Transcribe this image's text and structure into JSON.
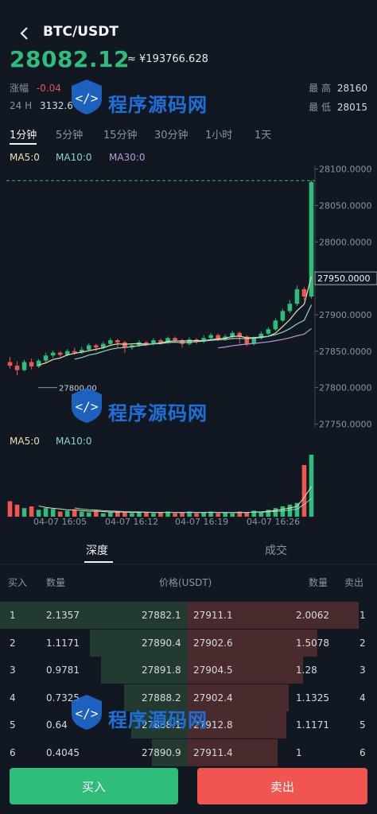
{
  "header": {
    "title": "BTC/USDT",
    "back_icon": "chevron-left-icon"
  },
  "ticker": {
    "price": "28082.12",
    "cny": "≈ ¥193766.628",
    "change_label": "涨幅",
    "change_value": "-0.04",
    "vol_label": "24 H",
    "vol_value": "3132.6",
    "high_label": "最 高",
    "high_value": "28160",
    "low_label": "最 低",
    "low_value": "28015"
  },
  "intervals": [
    "1分钟",
    "5分钟",
    "15分钟",
    "30分钟",
    "1小时",
    "1天"
  ],
  "ma_legend": {
    "ma5": "MA5:0",
    "ma10": "MA10:0",
    "ma30": "MA30:0"
  },
  "vol_legend": {
    "ma5": "MA5:0",
    "ma10": "MA10:0"
  },
  "colors": {
    "up": "#2ebd7a",
    "down": "#f0564f",
    "ma5": "#e8e0b0",
    "ma10": "#8fd3c8",
    "ma30": "#b79ae0"
  },
  "chart_data": {
    "type": "candlestick",
    "y_ticks": [
      "28100.0000",
      "28050.0000",
      "28000.0000",
      "27950.0000",
      "27900.0000",
      "27850.0000",
      "27800.0000",
      "27750.0000"
    ],
    "ylim": [
      27745,
      28105
    ],
    "current_price_label": "27950.0000",
    "high_marker": "28082",
    "low_marker": "27800.00",
    "x_ticks": [
      "04-07 16:05",
      "04-07 16:12",
      "04-07 16:19",
      "04-07 16:26"
    ],
    "candles": [
      [
        27835,
        27830,
        27842,
        27826
      ],
      [
        27830,
        27824,
        27836,
        27817
      ],
      [
        27824,
        27835,
        27838,
        27822
      ],
      [
        27835,
        27829,
        27840,
        27825
      ],
      [
        27829,
        27837,
        27839,
        27827
      ],
      [
        27837,
        27844,
        27848,
        27834
      ],
      [
        27844,
        27848,
        27851,
        27841
      ],
      [
        27848,
        27845,
        27850,
        27842
      ],
      [
        27845,
        27850,
        27853,
        27843
      ],
      [
        27850,
        27848,
        27855,
        27845
      ],
      [
        27848,
        27852,
        27856,
        27846
      ],
      [
        27852,
        27858,
        27861,
        27850
      ],
      [
        27858,
        27855,
        27860,
        27850
      ],
      [
        27855,
        27860,
        27863,
        27853
      ],
      [
        27860,
        27865,
        27868,
        27858
      ],
      [
        27865,
        27862,
        27867,
        27855
      ],
      [
        27862,
        27855,
        27864,
        27848
      ],
      [
        27855,
        27858,
        27860,
        27852
      ],
      [
        27858,
        27862,
        27865,
        27856
      ],
      [
        27862,
        27860,
        27864,
        27857
      ],
      [
        27860,
        27865,
        27868,
        27858
      ],
      [
        27865,
        27862,
        27867,
        27859
      ],
      [
        27862,
        27868,
        27870,
        27860
      ],
      [
        27868,
        27865,
        27870,
        27862
      ],
      [
        27865,
        27860,
        27867,
        27855
      ],
      [
        27860,
        27866,
        27869,
        27858
      ],
      [
        27866,
        27863,
        27868,
        27860
      ],
      [
        27863,
        27868,
        27872,
        27861
      ],
      [
        27868,
        27872,
        27875,
        27866
      ],
      [
        27872,
        27866,
        27874,
        27864
      ],
      [
        27866,
        27870,
        27873,
        27864
      ],
      [
        27870,
        27875,
        27878,
        27868
      ],
      [
        27875,
        27870,
        27877,
        27860
      ],
      [
        27870,
        27860,
        27872,
        27857
      ],
      [
        27860,
        27868,
        27870,
        27858
      ],
      [
        27868,
        27874,
        27877,
        27866
      ],
      [
        27874,
        27880,
        27883,
        27872
      ],
      [
        27880,
        27892,
        27895,
        27878
      ],
      [
        27892,
        27905,
        27908,
        27890
      ],
      [
        27905,
        27915,
        27920,
        27902
      ],
      [
        27915,
        27935,
        27940,
        27912
      ],
      [
        27935,
        27925,
        27938,
        27920
      ],
      [
        27925,
        28082,
        28084,
        27922
      ]
    ],
    "volumes": [
      18,
      14,
      10,
      12,
      8,
      10,
      9,
      6,
      7,
      8,
      6,
      5,
      7,
      4,
      5,
      6,
      5,
      4,
      6,
      5,
      4,
      5,
      6,
      4,
      5,
      6,
      4,
      5,
      6,
      4,
      5,
      4,
      6,
      5,
      7,
      6,
      8,
      10,
      12,
      14,
      16,
      60,
      72
    ]
  },
  "orderbook_tabs": [
    "深度",
    "成交"
  ],
  "orderbook_headers": {
    "buy": "买入",
    "qty": "数量",
    "price": "价格(USDT)",
    "qty2": "数量",
    "sell": "卖出"
  },
  "orderbook_rows": [
    {
      "idx": "1",
      "bq": "2.1357",
      "bp": "27882.1",
      "sp": "27911.1",
      "sq": "2.0062",
      "sidx": "1",
      "bfill": 1.0,
      "sfill": 0.95
    },
    {
      "idx": "2",
      "bq": "1.1171",
      "bp": "27890.4",
      "sp": "27902.6",
      "sq": "1.5078",
      "sidx": "2",
      "bfill": 0.52,
      "sfill": 0.72
    },
    {
      "idx": "3",
      "bq": "0.9781",
      "bp": "27891.8",
      "sp": "27904.5",
      "sq": "1.28",
      "sidx": "3",
      "bfill": 0.46,
      "sfill": 0.64
    },
    {
      "idx": "4",
      "bq": "0.7325",
      "bp": "27888.2",
      "sp": "27902.4",
      "sq": "1.1325",
      "sidx": "4",
      "bfill": 0.34,
      "sfill": 0.56
    },
    {
      "idx": "5",
      "bq": "0.64",
      "bp": "27888.1",
      "sp": "27912.8",
      "sq": "1.1171",
      "sidx": "5",
      "bfill": 0.3,
      "sfill": 0.55
    },
    {
      "idx": "6",
      "bq": "0.4045",
      "bp": "27890.9",
      "sp": "27911.4",
      "sq": "1",
      "sidx": "6",
      "bfill": 0.19,
      "sfill": 0.5
    }
  ],
  "actions": {
    "buy": "买入",
    "sell": "卖出"
  },
  "watermark": {
    "text": "程序源码网"
  }
}
